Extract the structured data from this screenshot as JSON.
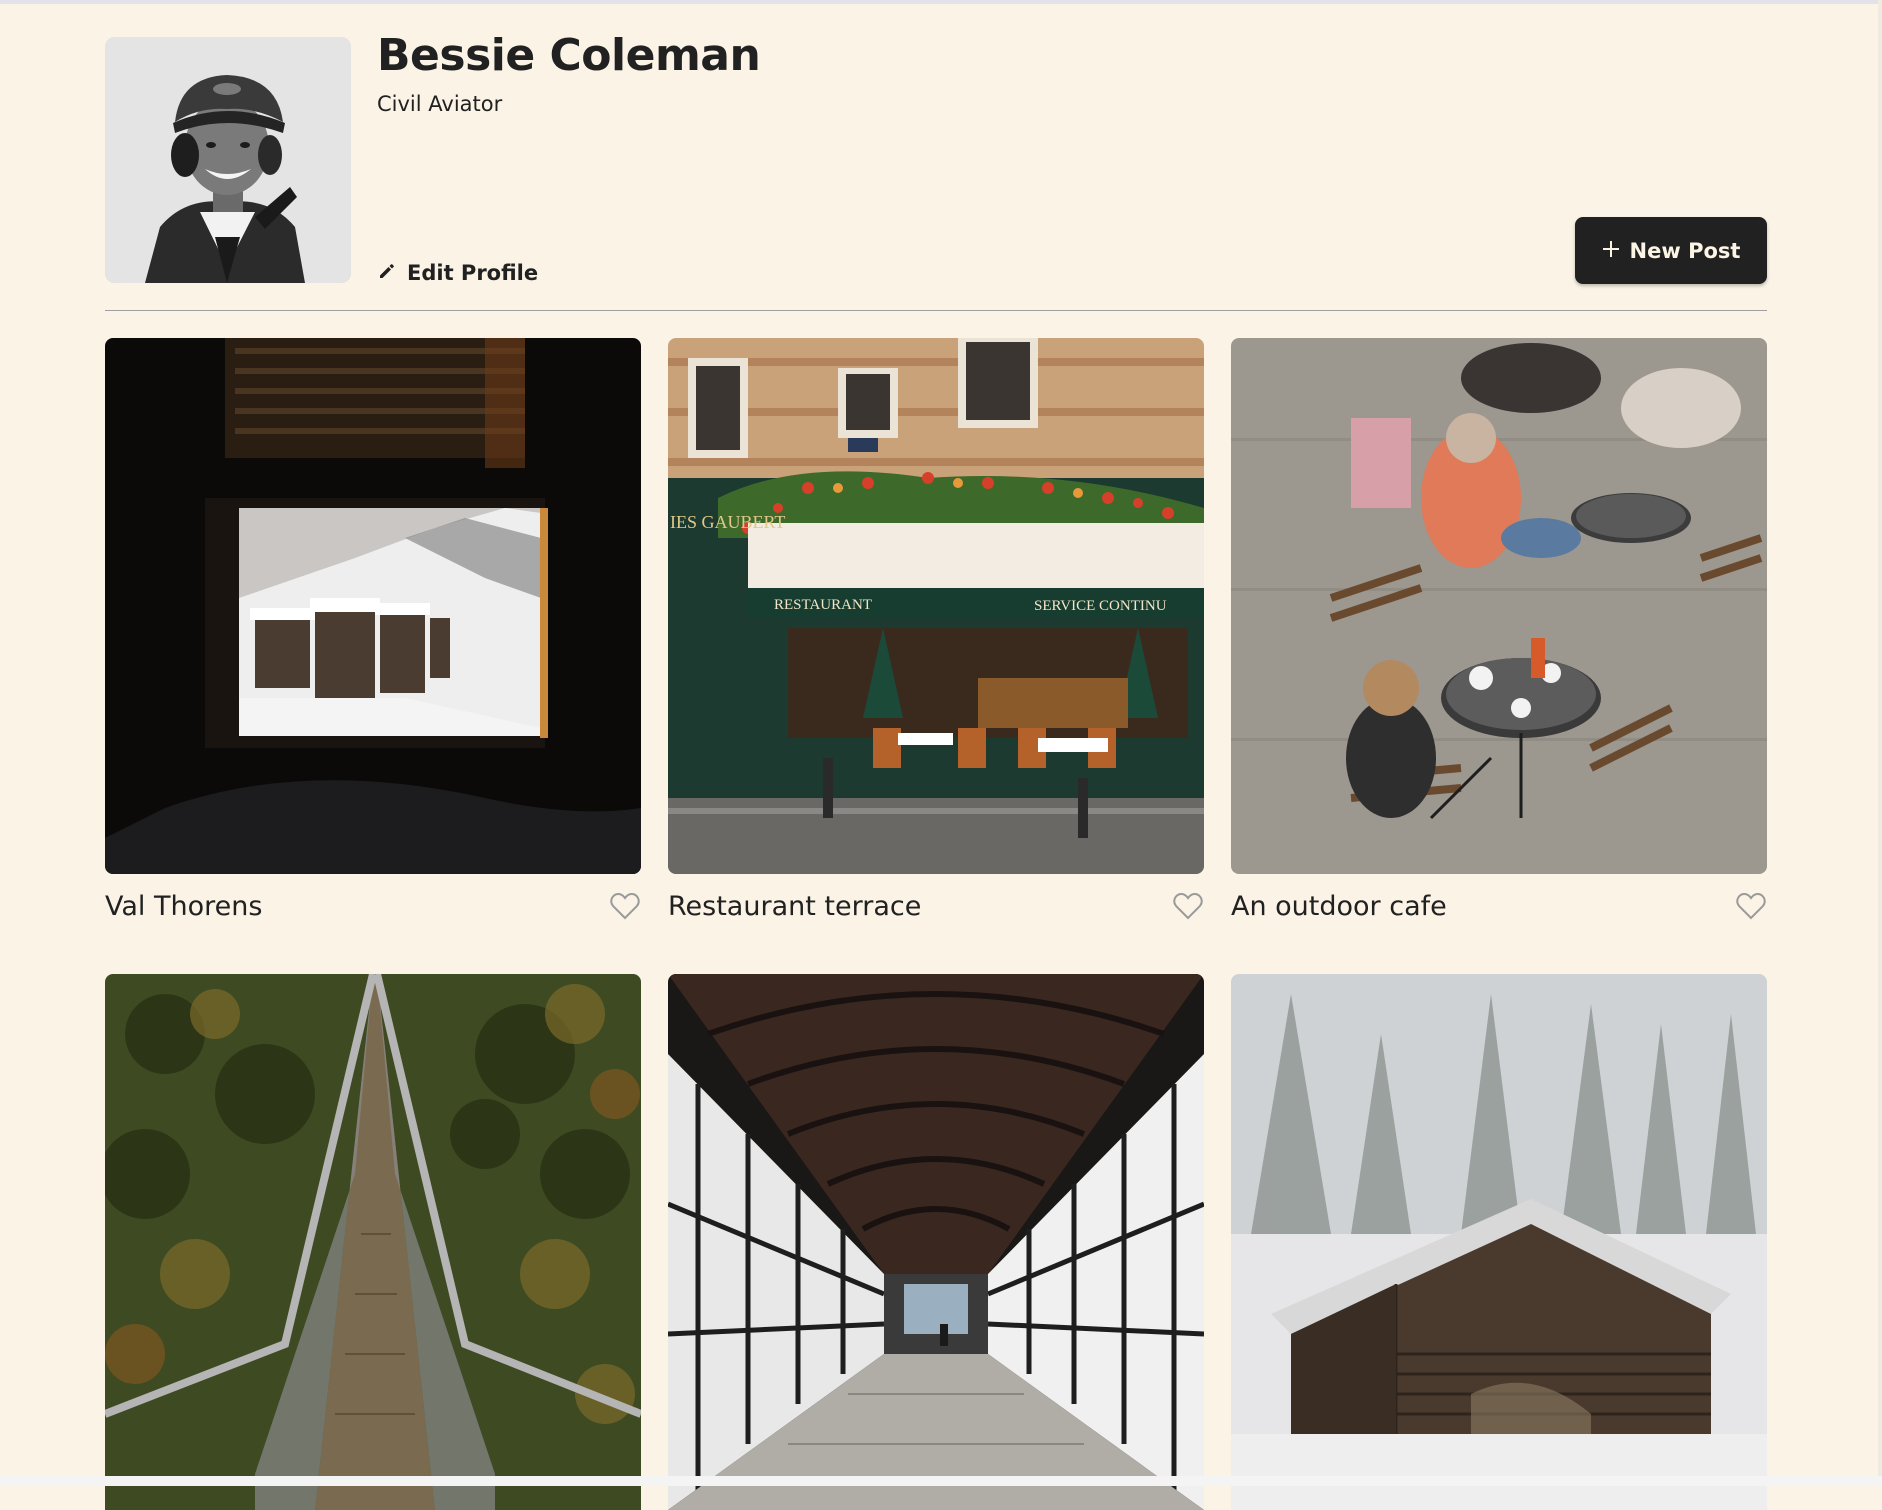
{
  "profile": {
    "name": "Bessie Coleman",
    "description": "Civil Aviator",
    "edit_label": "Edit Profile",
    "new_post_label": "New Post",
    "avatar_icon": "portrait-photo"
  },
  "cards": [
    {
      "title": "Val Thorens",
      "liked": false
    },
    {
      "title": "Restaurant terrace",
      "liked": false
    },
    {
      "title": "An outdoor cafe",
      "liked": false
    },
    {
      "title": "",
      "liked": false
    },
    {
      "title": "",
      "liked": false
    },
    {
      "title": "",
      "liked": false
    }
  ],
  "photo_text": {
    "restaurant_sign_left": "RESTAURANT",
    "restaurant_sign_right": "SERVICE CONTINU",
    "restaurant_name": "IES GAUBERT"
  },
  "colors": {
    "background": "#faf3e6",
    "text": "#212121",
    "button_bg": "#212121",
    "button_text": "#fcf5e5",
    "divider": "#9f9f9f"
  }
}
